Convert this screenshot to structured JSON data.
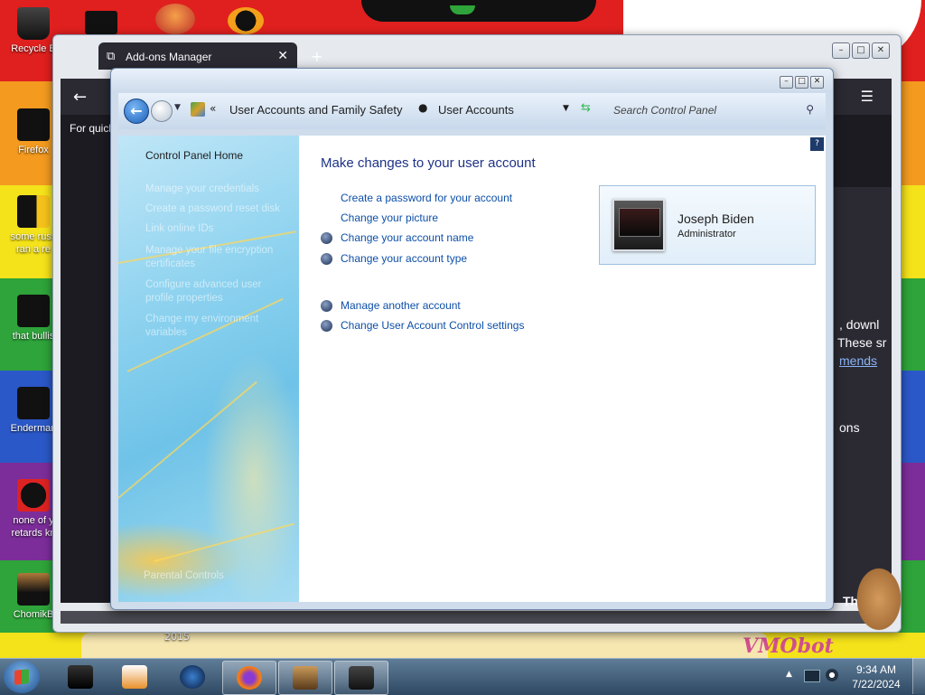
{
  "desktop": {
    "icons": [
      {
        "label": "Recycle B",
        "color": "#1a1a1a"
      },
      {
        "label": "Firefox",
        "color": "#e86a1c"
      },
      {
        "label": "some russ",
        "label2": "ran a re",
        "color": "#f4c21a"
      },
      {
        "label": "that bullis",
        "color": "#333333"
      },
      {
        "label": "Enderman",
        "color": "#222222"
      },
      {
        "label": "none of y",
        "label2": "retards kn",
        "color": "#d22"
      },
      {
        "label": "ChomikB",
        "color": "#b07a3a"
      }
    ],
    "year_fragment": "2015",
    "watermark": "VMObot"
  },
  "firefox": {
    "tab_title": "Add-ons Manager",
    "quick_text": "For quick",
    "text_downl": ", downl",
    "text_these": "These sr",
    "text_mends": "mends",
    "text_ons": "ons",
    "text_the": "The"
  },
  "control_panel": {
    "breadcrumb": [
      "User Accounts and Family Safety",
      "User Accounts"
    ],
    "search_placeholder": "Search Control Panel",
    "sidebar": {
      "home": "Control Panel Home",
      "faint_items": [
        "Manage your credentials",
        "Create a password reset disk",
        "Link online IDs",
        "Manage your file encryption certificates",
        "Configure advanced user profile properties",
        "Change my environment variables"
      ],
      "see_also": "Parental Controls"
    },
    "heading": "Make changes to your user account",
    "tasks": [
      {
        "label": "Create a password for your account",
        "shield": false
      },
      {
        "label": "Change your picture",
        "shield": false
      },
      {
        "label": "Change your account name",
        "shield": true
      },
      {
        "label": "Change your account type",
        "shield": true
      }
    ],
    "other_tasks": [
      {
        "label": "Manage another account",
        "shield": true
      },
      {
        "label": "Change User Account Control settings",
        "shield": true
      }
    ],
    "user": {
      "name": "Joseph Biden",
      "role": "Administrator"
    }
  },
  "taskbar": {
    "time": "9:34 AM",
    "date": "7/22/2024",
    "pinned": [
      "device-manager",
      "media-player",
      "ie-globe",
      "firefox",
      "chomik-box",
      "control-panel"
    ]
  }
}
